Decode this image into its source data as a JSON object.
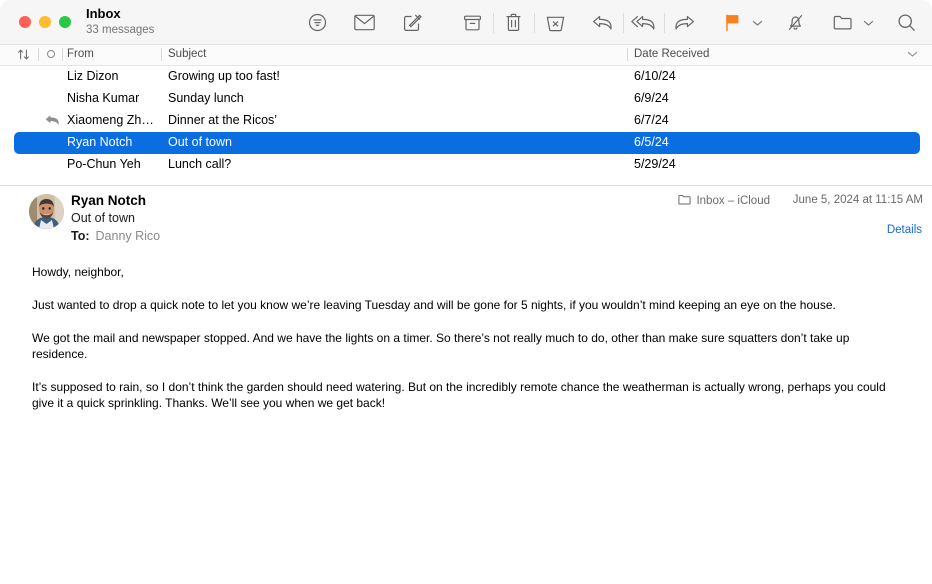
{
  "window": {
    "title": "Inbox",
    "subtitle": "33 messages",
    "traffic_lights": [
      "close",
      "minimize",
      "zoom"
    ]
  },
  "toolbar": {
    "items": [
      {
        "name": "filter-icon",
        "label": "Filter"
      },
      {
        "name": "mail-icon",
        "label": "Get Mail"
      },
      {
        "name": "compose-icon",
        "label": "New Message"
      },
      {
        "name": "archive-icon",
        "label": "Archive"
      },
      {
        "name": "trash-icon",
        "label": "Delete"
      },
      {
        "name": "junk-icon",
        "label": "Move to Junk"
      },
      {
        "name": "reply-icon",
        "label": "Reply"
      },
      {
        "name": "reply-all-icon",
        "label": "Reply All"
      },
      {
        "name": "forward-icon",
        "label": "Forward"
      },
      {
        "name": "flag-icon",
        "label": "Flag"
      },
      {
        "name": "chevron-down-icon",
        "label": "Flag Options"
      },
      {
        "name": "mute-icon",
        "label": "Mute"
      },
      {
        "name": "folder-icon",
        "label": "Move To"
      },
      {
        "name": "chevron-down-icon",
        "label": "Move To Options"
      },
      {
        "name": "search-icon",
        "label": "Search"
      }
    ],
    "flag_color": "#f58220"
  },
  "columns": {
    "sort_icon": "↑↓",
    "unread_icon": "unread-circle",
    "from": "From",
    "subject": "Subject",
    "date": "Date Received",
    "date_chevron": "chevron-down-icon"
  },
  "message_list": {
    "selected_index": 3,
    "selection_color": "#0a6ee1",
    "rows": [
      {
        "replied": false,
        "from": "Liz Dizon",
        "subject": "Growing up too fast!",
        "date": "6/10/24"
      },
      {
        "replied": false,
        "from": "Nisha Kumar",
        "subject": "Sunday lunch",
        "date": "6/9/24"
      },
      {
        "replied": true,
        "from": "Xiaomeng Zh…",
        "subject": "Dinner at the Ricos’",
        "date": "6/7/24"
      },
      {
        "replied": false,
        "from": "Ryan Notch",
        "subject": "Out of town",
        "date": "6/5/24"
      },
      {
        "replied": false,
        "from": "Po-Chun Yeh",
        "subject": "Lunch call?",
        "date": "5/29/24"
      }
    ]
  },
  "message": {
    "sender": "Ryan Notch",
    "subject": "Out of town",
    "to_label": "To:",
    "to_value": "Danny Rico",
    "mailbox": "Inbox – iCloud",
    "mailbox_icon": "folder-icon",
    "date": "June 5, 2024 at 11:15 AM",
    "details_label": "Details",
    "details_color": "#1269e0",
    "body": [
      "Howdy, neighbor,",
      "Just wanted to drop a quick note to let you know we’re leaving Tuesday and will be gone for 5 nights, if you wouldn’t mind keeping an eye on the house.",
      "We got the mail and newspaper stopped. And we have the lights on a timer. So there’s not really much to do, other than make sure squatters don’t take up residence.",
      "It’s supposed to rain, so I don’t think the garden should need watering. But on the incredibly remote chance the weatherman is actually wrong, perhaps you could give it a quick sprinkling. Thanks. We’ll see you when we get back!"
    ]
  }
}
